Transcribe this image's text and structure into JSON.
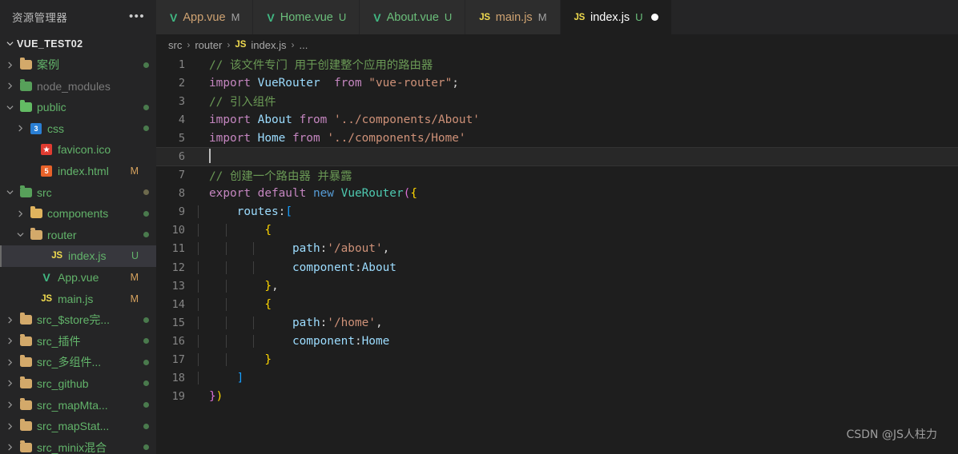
{
  "sidebar": {
    "title": "资源管理器",
    "more_label": "•••",
    "root": "VUE_TEST02",
    "items": [
      {
        "label": "案例",
        "type": "folder",
        "icon": "folder-tan-icon",
        "expanded": false,
        "indent": 1,
        "status": "dot-green",
        "badge": ""
      },
      {
        "label": "node_modules",
        "type": "folder",
        "icon": "folder-node-icon",
        "expanded": false,
        "indent": 1,
        "status": "",
        "badge": "",
        "dim": true
      },
      {
        "label": "public",
        "type": "folder",
        "icon": "folder-public-icon",
        "expanded": true,
        "indent": 1,
        "status": "dot-green",
        "badge": ""
      },
      {
        "label": "css",
        "type": "folder",
        "icon": "folder-css-icon",
        "expanded": false,
        "indent": 2,
        "status": "dot-green",
        "badge": ""
      },
      {
        "label": "favicon.ico",
        "type": "file",
        "icon": "favicon-star-icon",
        "expanded": null,
        "indent": 3,
        "status": "",
        "badge": ""
      },
      {
        "label": "index.html",
        "type": "file",
        "icon": "html5-icon",
        "expanded": null,
        "indent": 3,
        "status": "",
        "badge": "M"
      },
      {
        "label": "src",
        "type": "folder",
        "icon": "folder-src-icon",
        "expanded": true,
        "indent": 1,
        "status": "dot-olive",
        "badge": ""
      },
      {
        "label": "components",
        "type": "folder",
        "icon": "folder-components-icon",
        "expanded": false,
        "indent": 2,
        "status": "dot-green",
        "badge": ""
      },
      {
        "label": "router",
        "type": "folder",
        "icon": "folder-tan-icon",
        "expanded": true,
        "indent": 2,
        "status": "dot-green",
        "badge": ""
      },
      {
        "label": "index.js",
        "type": "file",
        "icon": "js-icon",
        "expanded": null,
        "indent": 4,
        "status": "",
        "badge": "U",
        "selected": true
      },
      {
        "label": "App.vue",
        "type": "file",
        "icon": "vue-icon",
        "expanded": null,
        "indent": 3,
        "status": "",
        "badge": "M"
      },
      {
        "label": "main.js",
        "type": "file",
        "icon": "js-icon",
        "expanded": null,
        "indent": 3,
        "status": "",
        "badge": "M"
      },
      {
        "label": "src_$store完...",
        "type": "folder",
        "icon": "folder-tan-icon",
        "expanded": false,
        "indent": 1,
        "status": "dot-green",
        "badge": ""
      },
      {
        "label": "src_插件",
        "type": "folder",
        "icon": "folder-tan-icon",
        "expanded": false,
        "indent": 1,
        "status": "dot-green",
        "badge": ""
      },
      {
        "label": "src_多组件...",
        "type": "folder",
        "icon": "folder-tan-icon",
        "expanded": false,
        "indent": 1,
        "status": "dot-green",
        "badge": ""
      },
      {
        "label": "src_github",
        "type": "folder",
        "icon": "folder-tan-icon",
        "expanded": false,
        "indent": 1,
        "status": "dot-green",
        "badge": ""
      },
      {
        "label": "src_mapMta...",
        "type": "folder",
        "icon": "folder-tan-icon",
        "expanded": false,
        "indent": 1,
        "status": "dot-green",
        "badge": ""
      },
      {
        "label": "src_mapStat...",
        "type": "folder",
        "icon": "folder-tan-icon",
        "expanded": false,
        "indent": 1,
        "status": "dot-green",
        "badge": ""
      },
      {
        "label": "src_minix混合",
        "type": "folder",
        "icon": "folder-tan-icon",
        "expanded": false,
        "indent": 1,
        "status": "dot-green",
        "badge": ""
      }
    ]
  },
  "tabs": [
    {
      "label": "App.vue",
      "icon": "vue-icon",
      "badge": "M",
      "active": false,
      "dirty": false,
      "name_class": "vue mod"
    },
    {
      "label": "Home.vue",
      "icon": "vue-icon",
      "badge": "U",
      "active": false,
      "dirty": false,
      "name_class": "vue"
    },
    {
      "label": "About.vue",
      "icon": "vue-icon",
      "badge": "U",
      "active": false,
      "dirty": false,
      "name_class": "vue"
    },
    {
      "label": "main.js",
      "icon": "js-icon",
      "badge": "M",
      "active": false,
      "dirty": false,
      "name_class": "jsm"
    },
    {
      "label": "index.js",
      "icon": "js-icon",
      "badge": "U",
      "active": true,
      "dirty": true,
      "name_class": "jsu"
    }
  ],
  "breadcrumb": {
    "part1": "src",
    "part2": "router",
    "js_icon": "JS",
    "part3": "index.js",
    "part4": "...",
    "separator": "›"
  },
  "code": {
    "lines": [
      {
        "n": "1",
        "tokens": [
          {
            "t": "// 该文件专门 用于创建整个应用的路由器",
            "c": "t-com"
          }
        ]
      },
      {
        "n": "2",
        "tokens": [
          {
            "t": "import",
            "c": "t-key"
          },
          {
            "t": " ",
            "c": "t-pl"
          },
          {
            "t": "VueRouter",
            "c": "t-var"
          },
          {
            "t": "  ",
            "c": "t-pl"
          },
          {
            "t": "from",
            "c": "t-key"
          },
          {
            "t": " ",
            "c": "t-pl"
          },
          {
            "t": "\"vue-router\"",
            "c": "t-str"
          },
          {
            "t": ";",
            "c": "t-pl"
          }
        ]
      },
      {
        "n": "3",
        "tokens": [
          {
            "t": "// 引入组件",
            "c": "t-com"
          }
        ]
      },
      {
        "n": "4",
        "tokens": [
          {
            "t": "import",
            "c": "t-key"
          },
          {
            "t": " ",
            "c": "t-pl"
          },
          {
            "t": "About",
            "c": "t-var"
          },
          {
            "t": " ",
            "c": "t-pl"
          },
          {
            "t": "from",
            "c": "t-key"
          },
          {
            "t": " ",
            "c": "t-pl"
          },
          {
            "t": "'../components/About'",
            "c": "t-str"
          }
        ]
      },
      {
        "n": "5",
        "tokens": [
          {
            "t": "import",
            "c": "t-key"
          },
          {
            "t": " ",
            "c": "t-pl"
          },
          {
            "t": "Home",
            "c": "t-var"
          },
          {
            "t": " ",
            "c": "t-pl"
          },
          {
            "t": "from",
            "c": "t-key"
          },
          {
            "t": " ",
            "c": "t-pl"
          },
          {
            "t": "'../components/Home'",
            "c": "t-str"
          }
        ]
      },
      {
        "n": "6",
        "tokens": [],
        "current": true,
        "cursor": true
      },
      {
        "n": "7",
        "tokens": [
          {
            "t": "// 创建一个路由器 并暴露",
            "c": "t-com"
          }
        ]
      },
      {
        "n": "8",
        "tokens": [
          {
            "t": "export",
            "c": "t-key"
          },
          {
            "t": " ",
            "c": "t-pl"
          },
          {
            "t": "default",
            "c": "t-key"
          },
          {
            "t": " ",
            "c": "t-pl"
          },
          {
            "t": "new",
            "c": "t-kw2"
          },
          {
            "t": " ",
            "c": "t-pl"
          },
          {
            "t": "VueRouter",
            "c": "t-fn"
          },
          {
            "t": "(",
            "c": "t-p"
          },
          {
            "t": "{",
            "c": "t-y"
          }
        ]
      },
      {
        "n": "9",
        "tokens": [
          {
            "t": "    ",
            "c": "t-pl"
          },
          {
            "t": "routes",
            "c": "t-var"
          },
          {
            "t": ":",
            "c": "t-pl"
          },
          {
            "t": "[",
            "c": "t-b"
          }
        ]
      },
      {
        "n": "10",
        "tokens": [
          {
            "t": "        ",
            "c": "t-pl"
          },
          {
            "t": "{",
            "c": "t-y"
          }
        ]
      },
      {
        "n": "11",
        "tokens": [
          {
            "t": "            ",
            "c": "t-pl"
          },
          {
            "t": "path",
            "c": "t-var"
          },
          {
            "t": ":",
            "c": "t-pl"
          },
          {
            "t": "'/about'",
            "c": "t-str"
          },
          {
            "t": ",",
            "c": "t-pl"
          }
        ]
      },
      {
        "n": "12",
        "tokens": [
          {
            "t": "            ",
            "c": "t-pl"
          },
          {
            "t": "component",
            "c": "t-var"
          },
          {
            "t": ":",
            "c": "t-pl"
          },
          {
            "t": "About",
            "c": "t-var"
          }
        ]
      },
      {
        "n": "13",
        "tokens": [
          {
            "t": "        ",
            "c": "t-pl"
          },
          {
            "t": "}",
            "c": "t-y"
          },
          {
            "t": ",",
            "c": "t-pl"
          }
        ]
      },
      {
        "n": "14",
        "tokens": [
          {
            "t": "        ",
            "c": "t-pl"
          },
          {
            "t": "{",
            "c": "t-y"
          }
        ]
      },
      {
        "n": "15",
        "tokens": [
          {
            "t": "            ",
            "c": "t-pl"
          },
          {
            "t": "path",
            "c": "t-var"
          },
          {
            "t": ":",
            "c": "t-pl"
          },
          {
            "t": "'/home'",
            "c": "t-str"
          },
          {
            "t": ",",
            "c": "t-pl"
          }
        ]
      },
      {
        "n": "16",
        "tokens": [
          {
            "t": "            ",
            "c": "t-pl"
          },
          {
            "t": "component",
            "c": "t-var"
          },
          {
            "t": ":",
            "c": "t-pl"
          },
          {
            "t": "Home",
            "c": "t-var"
          }
        ]
      },
      {
        "n": "17",
        "tokens": [
          {
            "t": "        ",
            "c": "t-pl"
          },
          {
            "t": "}",
            "c": "t-y"
          }
        ]
      },
      {
        "n": "18",
        "tokens": [
          {
            "t": "    ",
            "c": "t-pl"
          },
          {
            "t": "]",
            "c": "t-b"
          }
        ]
      },
      {
        "n": "19",
        "tokens": [
          {
            "t": "}",
            "c": "t-p"
          },
          {
            "t": ")",
            "c": "t-y"
          }
        ]
      }
    ]
  },
  "watermark": "CSDN @JS人柱力",
  "colors": {
    "editor_bg": "#1e1e1e",
    "sidebar_bg": "#252526",
    "tab_inactive_bg": "#2d2d2d",
    "selection_bg": "#37373d",
    "accent_green": "#62b36a",
    "modified_orange": "#cfa372",
    "js_yellow": "#f0db4f"
  }
}
